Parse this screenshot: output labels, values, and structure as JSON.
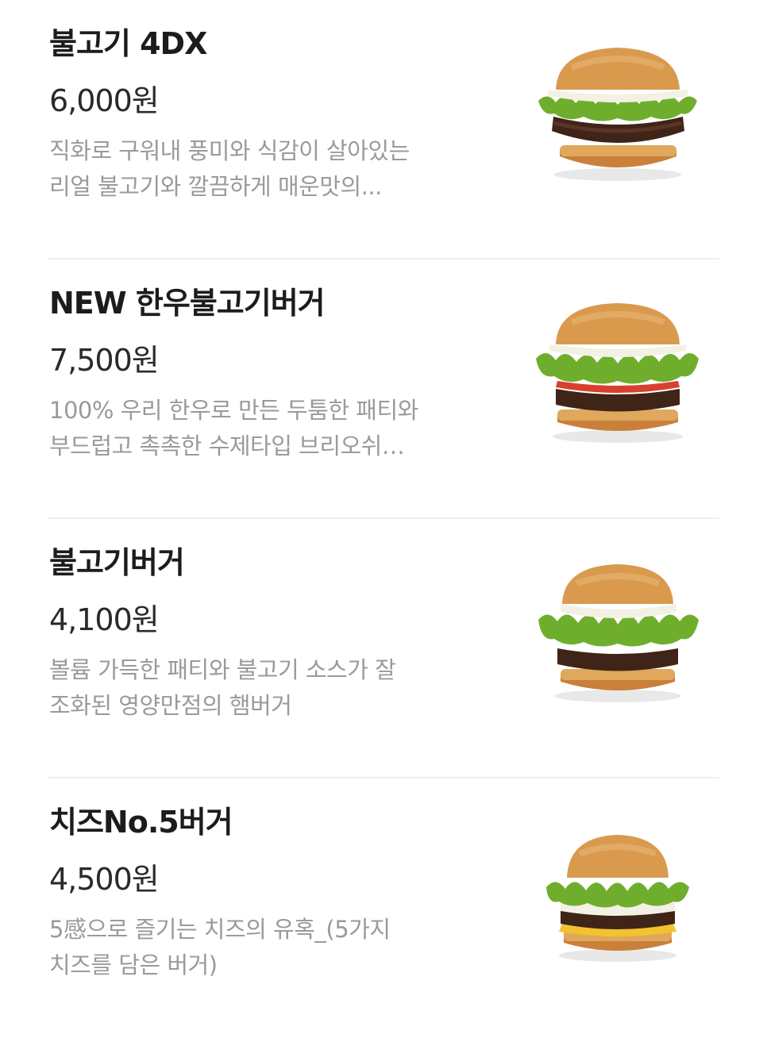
{
  "menu": {
    "items": [
      {
        "name": "불고기 4DX",
        "price": "6,000원",
        "desc_line1": "직화로 구워내 풍미와 식감이 살아있는",
        "desc_line2": "리얼 불고기와 깔끔하게 매운맛의...",
        "image_icon": "burger-image"
      },
      {
        "name": "NEW 한우불고기버거",
        "price": "7,500원",
        "desc_line1": "100% 우리 한우로 만든 두툼한 패티와",
        "desc_line2": "부드럽고 촉촉한 수제타입 브리오쉬…",
        "image_icon": "burger-image"
      },
      {
        "name": "불고기버거",
        "price": "4,100원",
        "desc_line1": "볼륨 가득한 패티와 불고기 소스가 잘",
        "desc_line2": "조화된 영양만점의 햄버거",
        "image_icon": "burger-image"
      },
      {
        "name": "치즈No.5버거",
        "price": "4,500원",
        "desc_line1": "5感으로 즐기는 치즈의 유혹_(5가지",
        "desc_line2": "치즈를 담은 버거)",
        "image_icon": "burger-image"
      }
    ]
  },
  "colors": {
    "bun": "#d99a4e",
    "lettuce": "#6fae2d",
    "patty": "#4a2a1c",
    "tomato": "#d8402e",
    "cheese": "#f2c230",
    "sauce": "#f3f0e4",
    "divider": "#eeeeee",
    "description": "#9a9a9a"
  }
}
